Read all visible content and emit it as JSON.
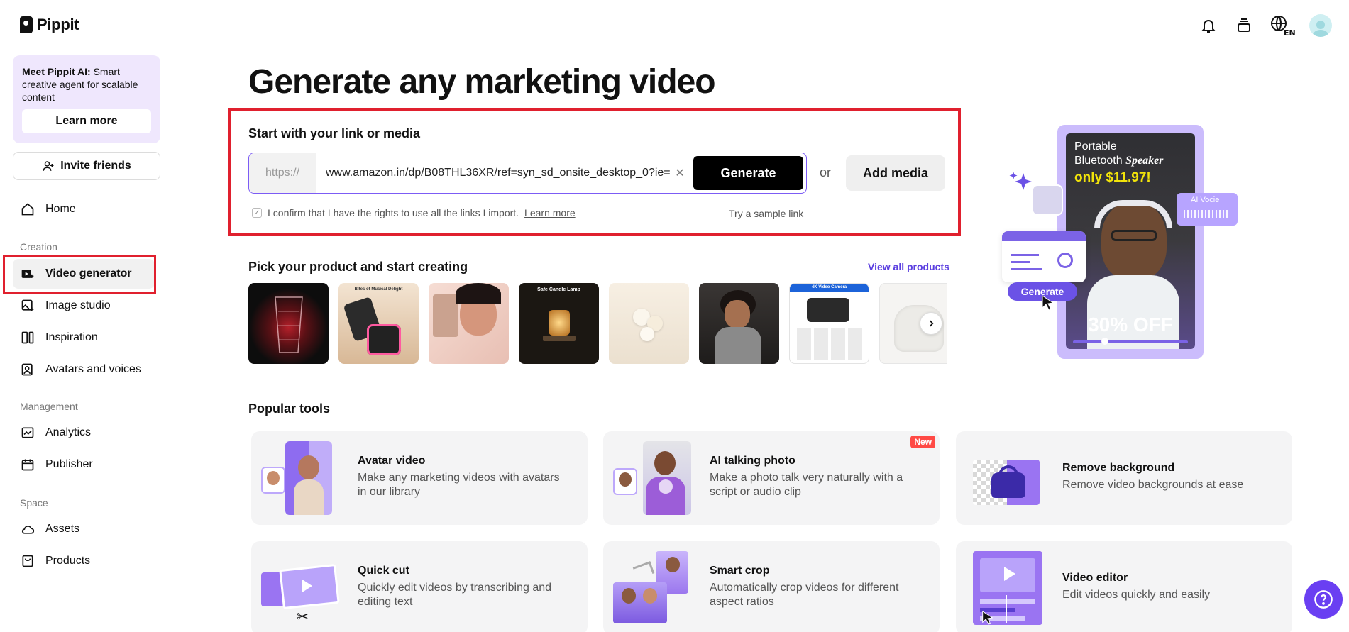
{
  "brand": {
    "name": "Pippit"
  },
  "sidebar": {
    "promo_title": "Meet Pippit AI:",
    "promo_text": " Smart creative agent for scalable content",
    "promo_button": "Learn more",
    "invite_label": "Invite friends",
    "home_label": "Home",
    "sections": {
      "creation": "Creation",
      "management": "Management",
      "space": "Space"
    },
    "creation_items": [
      {
        "label": "Video generator",
        "icon": "video-plus-icon",
        "active": true
      },
      {
        "label": "Image studio",
        "icon": "image-plus-icon"
      },
      {
        "label": "Inspiration",
        "icon": "inspiration-icon"
      },
      {
        "label": "Avatars and voices",
        "icon": "avatar-icon"
      }
    ],
    "management_items": [
      {
        "label": "Analytics",
        "icon": "analytics-icon"
      },
      {
        "label": "Publisher",
        "icon": "calendar-icon"
      }
    ],
    "space_items": [
      {
        "label": "Assets",
        "icon": "cloud-icon"
      },
      {
        "label": "Products",
        "icon": "product-icon"
      }
    ]
  },
  "topbar": {
    "icons": [
      "bell-icon",
      "layers-icon",
      "globe-en-icon",
      "user-avatar"
    ],
    "lang": "EN"
  },
  "main": {
    "title": "Generate any marketing video",
    "link_section_title": "Start with your link or media",
    "url_prefix": "https://",
    "url_value": "www.amazon.in/dp/B08THL36XR/ref=syn_sd_onsite_desktop_0?ie=",
    "generate_label": "Generate",
    "or_label": "or",
    "add_media_label": "Add media",
    "confirm_text": "I confirm that I have the rights to use all the links I import.",
    "confirm_link": "Learn more",
    "sample_link": "Try a sample link",
    "products_title": "Pick your product and start creating",
    "view_all": "View all products",
    "thumb_texts": {
      "musical": "Bites of Musical Delight",
      "candle": "Safe Candle Lamp",
      "camera": "4K Video Camera"
    }
  },
  "hero": {
    "line1": "Portable",
    "line2": "Bluetooth ",
    "line2_em": "Speaker",
    "price": "only $11.97!",
    "discount": "30% OFF",
    "voice_label": "AI Vocie",
    "generate_chip": "Generate"
  },
  "tools": {
    "title": "Popular tools",
    "items": [
      {
        "name": "Avatar video",
        "desc": "Make any marketing videos with avatars in our library"
      },
      {
        "name": "AI talking photo",
        "desc": "Make a photo talk very naturally with a script or audio clip",
        "badge": "New"
      },
      {
        "name": "Remove background",
        "desc": "Remove video backgrounds at ease"
      },
      {
        "name": "Quick cut",
        "desc": "Quickly edit videos by transcribing and editing text"
      },
      {
        "name": "Smart crop",
        "desc": "Automatically crop videos for different aspect ratios"
      },
      {
        "name": "Video editor",
        "desc": "Edit videos quickly and easily"
      }
    ]
  },
  "colors": {
    "accent": "#6a3ff2",
    "highlight": "#e0202e",
    "promo_bg": "#efe7fd"
  }
}
